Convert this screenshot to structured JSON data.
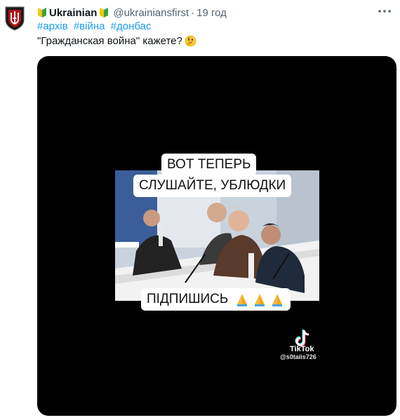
{
  "tweet": {
    "display_name": "Ukrainian",
    "handle": "@ukrainiansfirst",
    "separator": "·",
    "time": "19 год",
    "hashtags": [
      "#архів",
      "#війна",
      "#донбас"
    ],
    "text": "\"Гражданская война\" кажете?",
    "colors": {
      "link": "#1d9bf0",
      "secondary": "#536471",
      "primary": "#0f1419"
    }
  },
  "icons": {
    "avatar": "trident-shield-icon",
    "badge": "beginner-badge-icon",
    "more": "more-dots-icon",
    "thinking": "thinking-face-emoji",
    "pray": "folded-hands-emoji",
    "tiktok": "tiktok-icon"
  },
  "video": {
    "caption_line1": "ВОТ ТЕПЕРЬ",
    "caption_line2": "СЛУШАЙТЕ, УБЛЮДКИ",
    "caption_bottom": "ПІДПИШИСЬ",
    "watermark_brand": "TikTok",
    "watermark_user": "@s0taiis726"
  }
}
